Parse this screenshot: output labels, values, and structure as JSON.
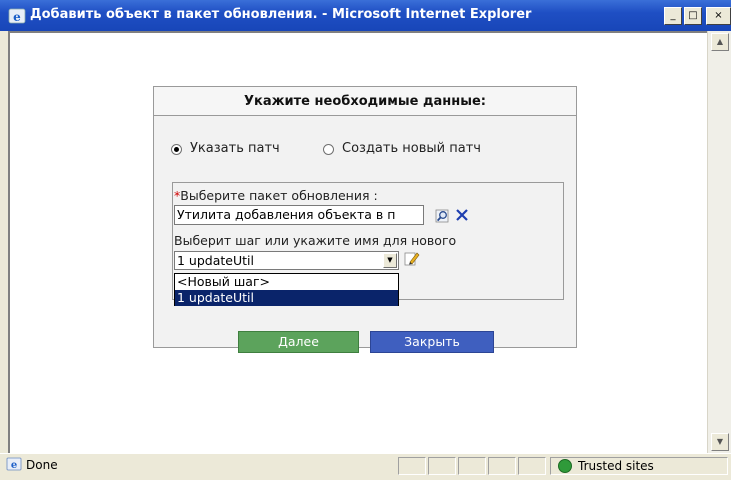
{
  "window": {
    "title": "Добавить объект в пакет обновления. - Microsoft Internet Explorer",
    "minimize_glyph": "_",
    "maximize_glyph": "□",
    "close_glyph": "×"
  },
  "dialog": {
    "title": "Укажите необходимые данные:",
    "radio_specify_patch": "Указать патч",
    "radio_create_patch": "Создать новый патч",
    "selected_radio": "specify_patch",
    "package_label_required": "*",
    "package_label": "Выберите пакет обновления :",
    "package_value": "Утилита добавления объекта в п",
    "step_label": "Выберит шаг или укажите имя для нового",
    "step_value": "1 updateUtil",
    "step_options": [
      "<Новый шаг>",
      "1 updateUtil"
    ],
    "step_options_selected_index": 1,
    "next_button": "Далее",
    "close_button": "Закрыть"
  },
  "icons": {
    "browse": "magnifier-icon",
    "clear": "red-x-icon",
    "edit": "pencil-icon"
  },
  "statusbar": {
    "status": "Done",
    "zone": "Trusted sites"
  },
  "colors": {
    "titlebar": "#1f4fc4",
    "next_button": "#5ca35c",
    "close_button": "#3f5fbf",
    "selected_option": "#0a246a",
    "required_mark": "#d00000"
  }
}
